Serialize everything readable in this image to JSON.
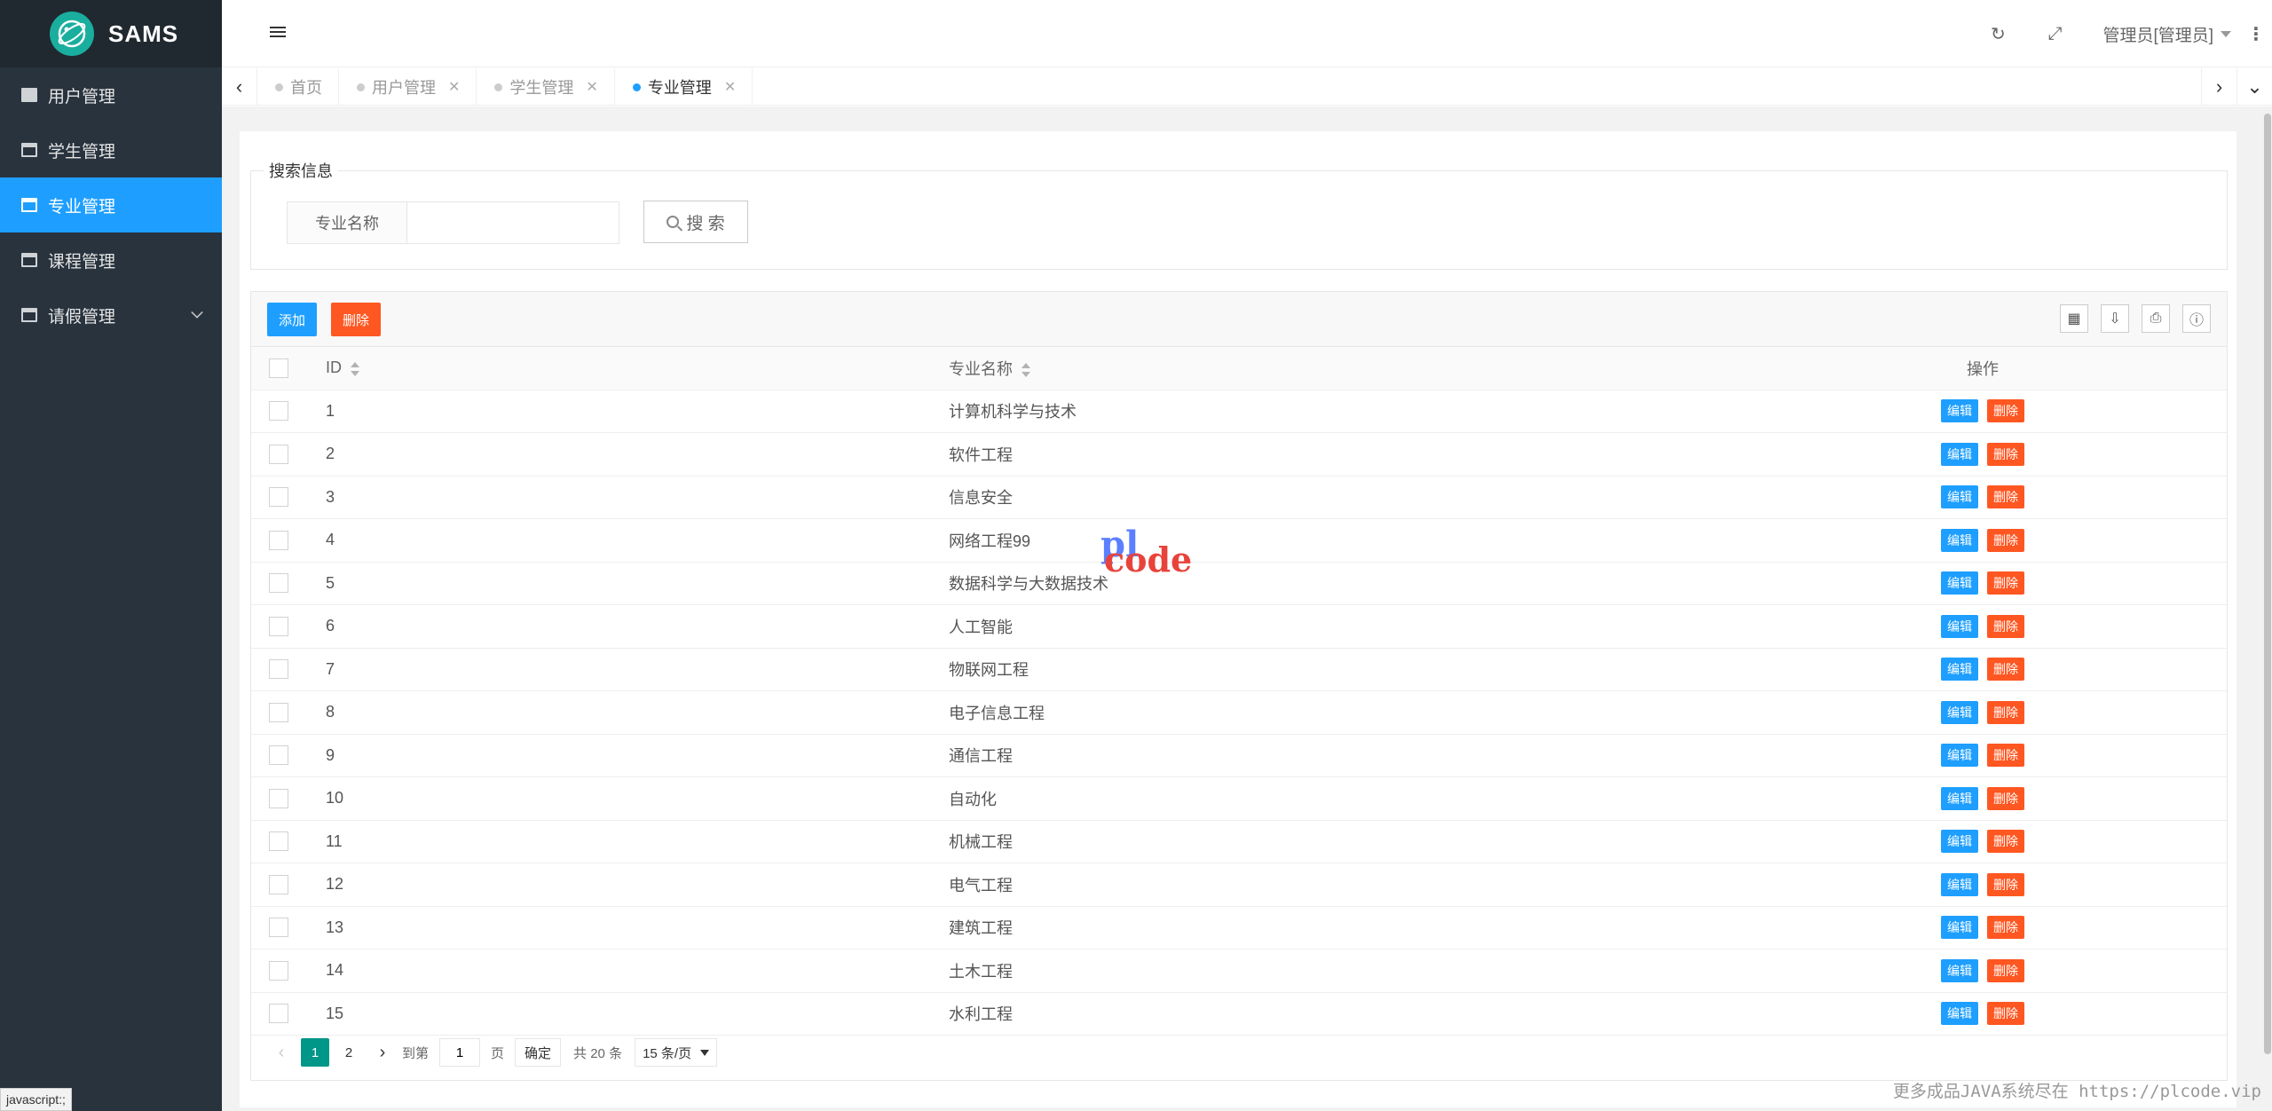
{
  "app": {
    "title": "SAMS"
  },
  "sidebar": {
    "items": [
      {
        "label": "用户管理",
        "icon": "document-icon"
      },
      {
        "label": "学生管理",
        "icon": "window-icon"
      },
      {
        "label": "专业管理",
        "icon": "window-icon",
        "active": true
      },
      {
        "label": "课程管理",
        "icon": "window-icon"
      },
      {
        "label": "请假管理",
        "icon": "window-icon",
        "expandable": true
      }
    ],
    "active_color": "#1e9fff",
    "bg_color": "#28333e"
  },
  "header": {
    "user": "管理员[管理员]",
    "icons": [
      "refresh-icon",
      "fullscreen-icon",
      "more-icon"
    ]
  },
  "tabs": [
    {
      "label": "首页",
      "closable": false
    },
    {
      "label": "用户管理",
      "closable": true
    },
    {
      "label": "学生管理",
      "closable": true
    },
    {
      "label": "专业管理",
      "closable": true,
      "active": true
    }
  ],
  "search": {
    "legend": "搜索信息",
    "label": "专业名称",
    "value": "",
    "button": "搜 索"
  },
  "toolbar": {
    "add_label": "添加",
    "delete_label": "删除",
    "icons": [
      "columns-icon",
      "export-icon",
      "print-icon",
      "info-icon"
    ]
  },
  "table": {
    "columns": [
      "ID",
      "专业名称",
      "操作"
    ],
    "edit_label": "编辑",
    "delete_label": "删除",
    "rows": [
      {
        "id": "1",
        "name": "计算机科学与技术"
      },
      {
        "id": "2",
        "name": "软件工程"
      },
      {
        "id": "3",
        "name": "信息安全"
      },
      {
        "id": "4",
        "name": "网络工程99"
      },
      {
        "id": "5",
        "name": "数据科学与大数据技术"
      },
      {
        "id": "6",
        "name": "人工智能"
      },
      {
        "id": "7",
        "name": "物联网工程"
      },
      {
        "id": "8",
        "name": "电子信息工程"
      },
      {
        "id": "9",
        "name": "通信工程"
      },
      {
        "id": "10",
        "name": "自动化"
      },
      {
        "id": "11",
        "name": "机械工程"
      },
      {
        "id": "12",
        "name": "电气工程"
      },
      {
        "id": "13",
        "name": "建筑工程"
      },
      {
        "id": "14",
        "name": "土木工程"
      },
      {
        "id": "15",
        "name": "水利工程"
      }
    ]
  },
  "pagination": {
    "pages": [
      "1",
      "2"
    ],
    "current": "1",
    "goto_label": "到第",
    "goto_value": "1",
    "page_unit": "页",
    "confirm": "确定",
    "total": "共 20 条",
    "page_size": "15 条/页"
  },
  "watermark": {
    "line1": "pl",
    "line2": "code"
  },
  "footer_note": "更多成品JAVA系统尽在 https://plcode.vip",
  "status_url": "javascript:;"
}
